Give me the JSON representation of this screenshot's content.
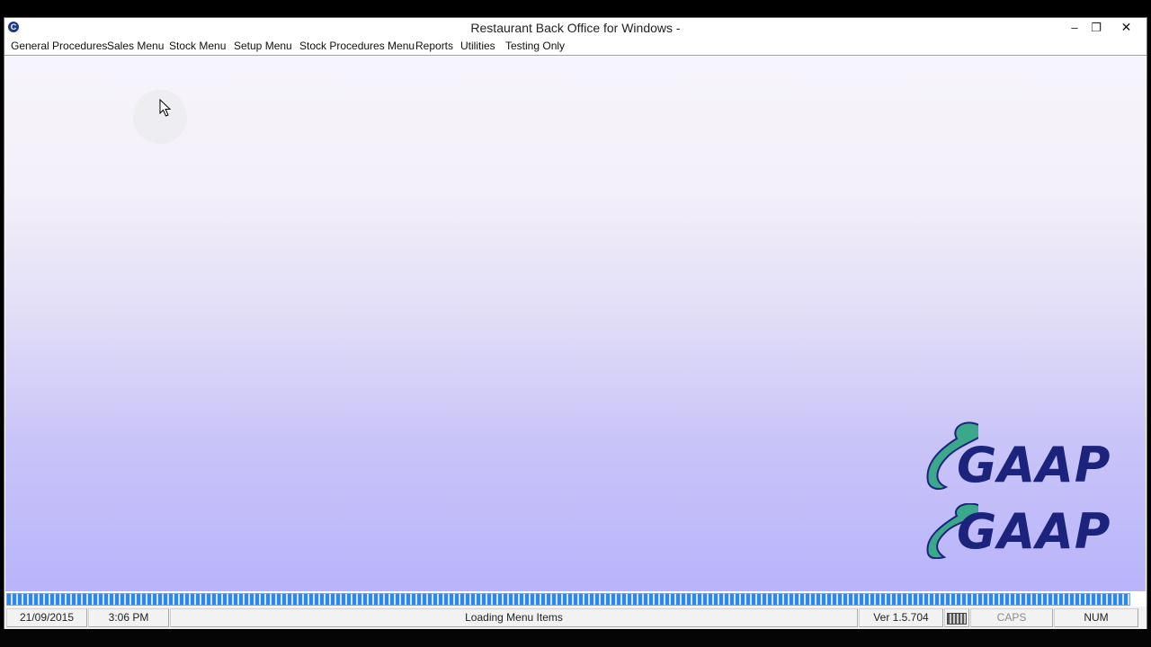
{
  "window": {
    "title": "Restaurant Back Office for Windows -",
    "app_icon": "app-icon",
    "controls": {
      "minimize": "–",
      "restore": "❐",
      "close": "✕"
    }
  },
  "menubar": {
    "items": [
      {
        "label": "General Procedures"
      },
      {
        "label": "Sales Menu"
      },
      {
        "label": "Stock Menu"
      },
      {
        "label": "Setup Menu"
      },
      {
        "label": "Stock Procedures Menu"
      },
      {
        "label": "Reports"
      },
      {
        "label": "Utilities"
      },
      {
        "label": "Testing Only"
      }
    ]
  },
  "logo": {
    "text": "GAAP",
    "color_text": "#1c237d",
    "color_swoosh": "#3aa88a"
  },
  "progress": {
    "fraction": 1.0,
    "color": "#2f87e8"
  },
  "statusbar": {
    "date": "21/09/2015",
    "time": "3:06 PM",
    "message": "Loading Menu Items",
    "version": "Ver 1.5.704",
    "keyboard_icon": "keyboard-icon",
    "caps": "CAPS",
    "num": "NUM"
  }
}
